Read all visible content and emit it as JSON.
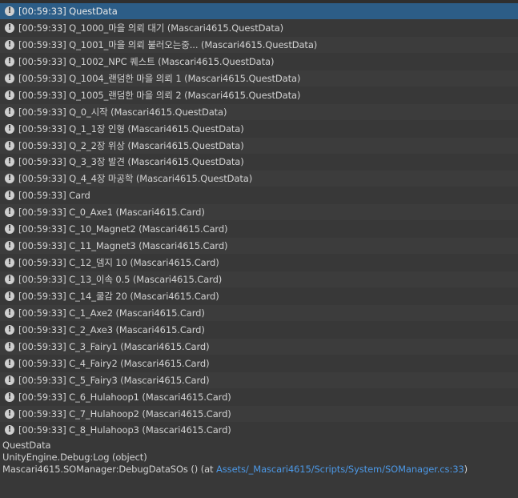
{
  "console": {
    "entries": [
      "[00:59:33] QuestData",
      "[00:59:33] Q_1000_마을 의뢰 대기 (Mascari4615.QuestData)",
      "[00:59:33] Q_1001_마을 의뢰 불러오는중... (Mascari4615.QuestData)",
      "[00:59:33] Q_1002_NPC 퀘스트 (Mascari4615.QuestData)",
      "[00:59:33] Q_1004_랜덤한 마을 의뢰 1 (Mascari4615.QuestData)",
      "[00:59:33] Q_1005_랜덤한 마을 의뢰 2 (Mascari4615.QuestData)",
      "[00:59:33] Q_0_시작 (Mascari4615.QuestData)",
      "[00:59:33] Q_1_1장  인형 (Mascari4615.QuestData)",
      "[00:59:33] Q_2_2장  위상 (Mascari4615.QuestData)",
      "[00:59:33] Q_3_3장  발견 (Mascari4615.QuestData)",
      "[00:59:33] Q_4_4장 마공학 (Mascari4615.QuestData)",
      "[00:59:33] Card",
      "[00:59:33] C_0_Axe1 (Mascari4615.Card)",
      "[00:59:33] C_10_Magnet2 (Mascari4615.Card)",
      "[00:59:33] C_11_Magnet3 (Mascari4615.Card)",
      "[00:59:33] C_12_뎀지 10 (Mascari4615.Card)",
      "[00:59:33] C_13_이속 0.5 (Mascari4615.Card)",
      "[00:59:33] C_14_쿨감 20 (Mascari4615.Card)",
      "[00:59:33] C_1_Axe2 (Mascari4615.Card)",
      "[00:59:33] C_2_Axe3 (Mascari4615.Card)",
      "[00:59:33] C_3_Fairy1 (Mascari4615.Card)",
      "[00:59:33] C_4_Fairy2 (Mascari4615.Card)",
      "[00:59:33] C_5_Fairy3 (Mascari4615.Card)",
      "[00:59:33] C_6_Hulahoop1 (Mascari4615.Card)",
      "[00:59:33] C_7_Hulahoop2 (Mascari4615.Card)",
      "[00:59:33] C_8_Hulahoop3 (Mascari4615.Card)"
    ],
    "selected_index": 0,
    "icon": "info-icon",
    "icon_glyph": "!"
  },
  "detail": {
    "message": "QuestData",
    "trace_line1": "UnityEngine.Debug:Log (object)",
    "trace_line2_prefix": "Mascari4615.SOManager:DebugDataSOs () (at ",
    "trace_line2_link": "Assets/_Mascari4615/Scripts/System/SOManager.cs:33",
    "trace_line2_suffix": ")"
  },
  "colors": {
    "background": "#383838",
    "row_background": "#3c3c3c",
    "selected_row": "#2c5d87",
    "text": "#d2d2d2",
    "link": "#4c98e6"
  }
}
